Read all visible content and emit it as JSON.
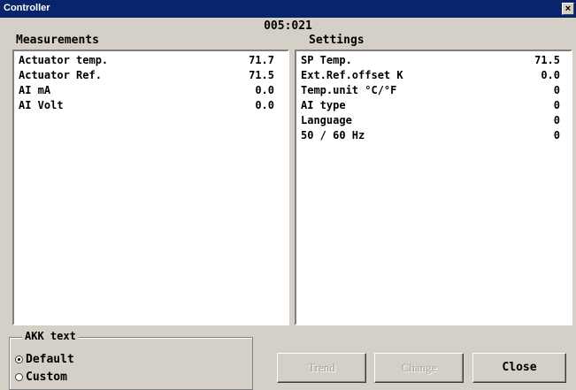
{
  "window": {
    "title": "Controller",
    "close_glyph": "×"
  },
  "header": {
    "code": "005:021"
  },
  "measurements": {
    "label": "Measurements",
    "rows": [
      {
        "name": "Actuator temp.",
        "value": "71.7"
      },
      {
        "name": "Actuator Ref.",
        "value": "71.5"
      },
      {
        "name": "AI mA",
        "value": "0.0"
      },
      {
        "name": "AI Volt",
        "value": "0.0"
      }
    ]
  },
  "settings": {
    "label": "Settings",
    "rows": [
      {
        "name": "SP Temp.",
        "value": "71.5"
      },
      {
        "name": "Ext.Ref.offset K",
        "value": "0.0"
      },
      {
        "name": "Temp.unit °C/°F",
        "value": "0"
      },
      {
        "name": "AI type",
        "value": "0"
      },
      {
        "name": "Language",
        "value": "0"
      },
      {
        "name": "50 / 60 Hz",
        "value": "0"
      }
    ]
  },
  "akk_text": {
    "legend": "AKK text",
    "options": [
      {
        "label": "Default",
        "selected": true
      },
      {
        "label": "Custom",
        "selected": false
      }
    ]
  },
  "buttons": {
    "trend": "Trend",
    "change": "Change",
    "close": "Close"
  }
}
